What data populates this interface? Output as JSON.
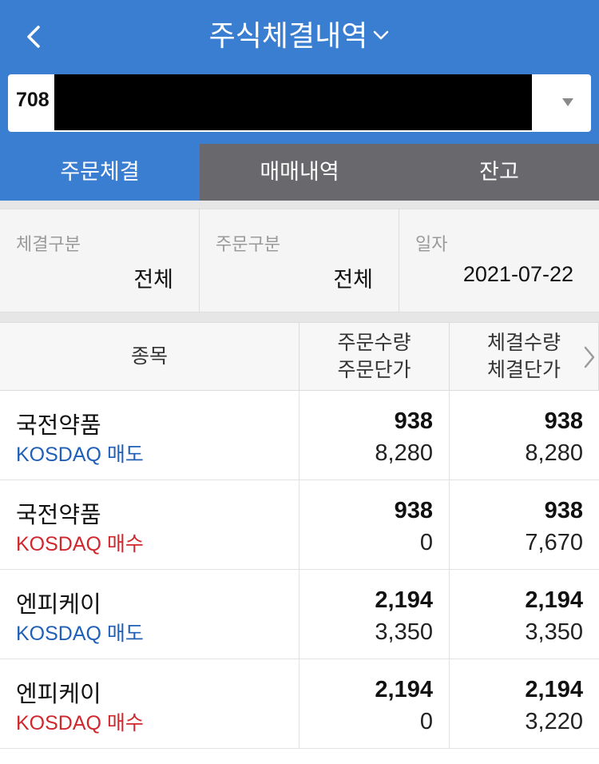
{
  "header": {
    "title": "주식체결내역"
  },
  "account": {
    "number_prefix": "708"
  },
  "tabs": [
    {
      "label": "주문체결",
      "active": true
    },
    {
      "label": "매매내역",
      "active": false
    },
    {
      "label": "잔고",
      "active": false
    }
  ],
  "filters": [
    {
      "label": "체결구분",
      "value": "전체"
    },
    {
      "label": "주문구분",
      "value": "전체"
    },
    {
      "label": "일자",
      "value": "2021-07-22"
    }
  ],
  "table": {
    "headers": {
      "col1": "종목",
      "col2_line1": "주문수량",
      "col2_line2": "주문단가",
      "col3_line1": "체결수량",
      "col3_line2": "체결단가"
    },
    "rows": [
      {
        "name": "국전약품",
        "sub": "KOSDAQ 매도",
        "side": "sell",
        "order_qty": "938",
        "order_price": "8,280",
        "exec_qty": "938",
        "exec_price": "8,280"
      },
      {
        "name": "국전약품",
        "sub": "KOSDAQ 매수",
        "side": "buy",
        "order_qty": "938",
        "order_price": "0",
        "exec_qty": "938",
        "exec_price": "7,670"
      },
      {
        "name": "엔피케이",
        "sub": "KOSDAQ 매도",
        "side": "sell",
        "order_qty": "2,194",
        "order_price": "3,350",
        "exec_qty": "2,194",
        "exec_price": "3,350"
      },
      {
        "name": "엔피케이",
        "sub": "KOSDAQ 매수",
        "side": "buy",
        "order_qty": "2,194",
        "order_price": "0",
        "exec_qty": "2,194",
        "exec_price": "3,220"
      }
    ]
  },
  "colors": {
    "primary_blue": "#3a7ed1",
    "tab_gray": "#69696d",
    "sell_blue": "#1f5fb8",
    "buy_red": "#d0262c"
  }
}
